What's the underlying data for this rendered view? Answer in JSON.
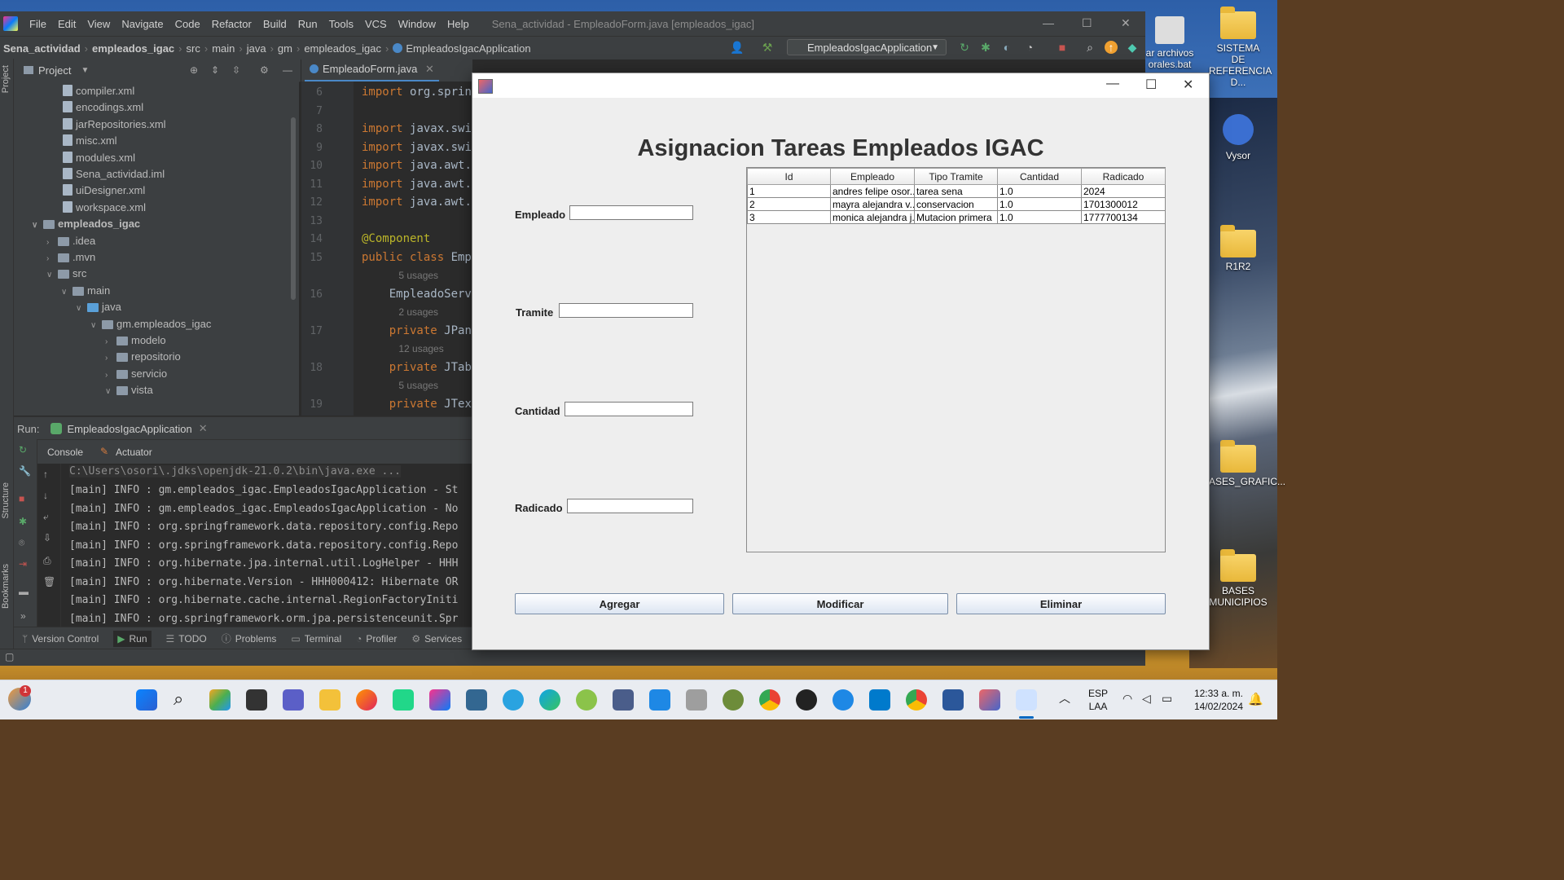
{
  "desktop": {
    "icons": [
      {
        "label": "ar archivos\norales.bat"
      },
      {
        "label": "SISTEMA DE\nREFERENCIA D..."
      },
      {
        "label": "Vysor"
      },
      {
        "label": "R1R2"
      },
      {
        "label": "ASES_GRAFIC..."
      },
      {
        "label": "BASES\nMUNICIPIOS"
      }
    ]
  },
  "ide": {
    "menu": [
      "File",
      "Edit",
      "View",
      "Navigate",
      "Code",
      "Refactor",
      "Build",
      "Run",
      "Tools",
      "VCS",
      "Window",
      "Help"
    ],
    "window_title": "Sena_actividad - EmpleadoForm.java [empleados_igac]",
    "breadcrumb": [
      "Sena_actividad",
      "empleados_igac",
      "src",
      "main",
      "java",
      "gm",
      "empleados_igac",
      "EmpleadosIgacApplication"
    ],
    "run_config": "EmpleadosIgacApplication",
    "project_label": "Project",
    "side_labels": {
      "project": "Project",
      "structure": "Structure",
      "bookmarks": "Bookmarks"
    },
    "tree": [
      {
        "label": "compiler.xml",
        "type": "xml"
      },
      {
        "label": "encodings.xml",
        "type": "xml"
      },
      {
        "label": "jarRepositories.xml",
        "type": "xml"
      },
      {
        "label": "misc.xml",
        "type": "xml"
      },
      {
        "label": "modules.xml",
        "type": "xml"
      },
      {
        "label": "Sena_actividad.iml",
        "type": "iml"
      },
      {
        "label": "uiDesigner.xml",
        "type": "xml"
      },
      {
        "label": "workspace.xml",
        "type": "xml"
      },
      {
        "label": "empleados_igac",
        "type": "folder"
      },
      {
        "label": ".idea",
        "type": "folder"
      },
      {
        "label": ".mvn",
        "type": "folder"
      },
      {
        "label": "src",
        "type": "folder"
      },
      {
        "label": "main",
        "type": "folder"
      },
      {
        "label": "java",
        "type": "folder"
      },
      {
        "label": "gm.empleados_igac",
        "type": "package"
      },
      {
        "label": "modelo",
        "type": "package"
      },
      {
        "label": "repositorio",
        "type": "package"
      },
      {
        "label": "servicio",
        "type": "package"
      },
      {
        "label": "vista",
        "type": "package"
      }
    ],
    "editor_tab": "EmpleadoForm.java",
    "code_lines": [
      {
        "n": "6",
        "parts": [
          [
            "kw",
            "import "
          ],
          [
            "",
            "org.spring"
          ]
        ]
      },
      {
        "n": "7",
        "parts": []
      },
      {
        "n": "8",
        "parts": [
          [
            "kw",
            "import "
          ],
          [
            "",
            "javax.swir"
          ]
        ]
      },
      {
        "n": "9",
        "parts": [
          [
            "kw",
            "import "
          ],
          [
            "",
            "javax.swir"
          ]
        ]
      },
      {
        "n": "10",
        "parts": [
          [
            "kw",
            "import "
          ],
          [
            "",
            "java.awt.*"
          ]
        ]
      },
      {
        "n": "11",
        "parts": [
          [
            "kw",
            "import "
          ],
          [
            "",
            "java.awt.e"
          ]
        ]
      },
      {
        "n": "12",
        "parts": [
          [
            "kw",
            "import "
          ],
          [
            "",
            "java.awt.e"
          ]
        ]
      },
      {
        "n": "13",
        "parts": []
      },
      {
        "n": "14",
        "parts": [
          [
            "an",
            "@Component"
          ]
        ]
      },
      {
        "n": "15",
        "parts": [
          [
            "kw",
            "public class "
          ],
          [
            "",
            "Empl"
          ]
        ]
      },
      {
        "n": "",
        "hint": "5 usages"
      },
      {
        "n": "16",
        "parts": [
          [
            "",
            "    EmpleadoServi"
          ]
        ]
      },
      {
        "n": "",
        "hint": "2 usages"
      },
      {
        "n": "17",
        "parts": [
          [
            "kw",
            "    private "
          ],
          [
            "",
            "JPane"
          ]
        ]
      },
      {
        "n": "",
        "hint": "12 usages"
      },
      {
        "n": "18",
        "parts": [
          [
            "kw",
            "    private "
          ],
          [
            "",
            "JTabl"
          ]
        ]
      },
      {
        "n": "",
        "hint": "5 usages"
      },
      {
        "n": "19",
        "parts": [
          [
            "kw",
            "    private "
          ],
          [
            "",
            "JText"
          ]
        ]
      }
    ],
    "run": {
      "label": "Run:",
      "tab": "EmpleadosIgacApplication",
      "console_tabs": [
        "Console",
        "Actuator"
      ],
      "console_lines": [
        "C:\\Users\\osori\\.jdks\\openjdk-21.0.2\\bin\\java.exe ...",
        "[main] INFO : gm.empleados_igac.EmpleadosIgacApplication - St",
        "[main] INFO : gm.empleados_igac.EmpleadosIgacApplication - No",
        "[main] INFO : org.springframework.data.repository.config.Repo",
        "[main] INFO : org.springframework.data.repository.config.Repo",
        "[main] INFO : org.hibernate.jpa.internal.util.LogHelper - HHH",
        "[main] INFO : org.hibernate.Version - HHH000412: Hibernate OR",
        "[main] INFO : org.hibernate.cache.internal.RegionFactoryIniti",
        "[main] INFO : org.springframework.orm.jpa.persistenceunit.Spr"
      ]
    },
    "bottom_tabs": [
      "Version Control",
      "Run",
      "TODO",
      "Problems",
      "Terminal",
      "Profiler",
      "Services"
    ]
  },
  "form": {
    "title": "Asignacion Tareas Empleados IGAC",
    "fields": {
      "empleado": {
        "label": "Empleado",
        "value": ""
      },
      "tramite": {
        "label": "Tramite",
        "value": ""
      },
      "cantidad": {
        "label": "Cantidad",
        "value": ""
      },
      "radicado": {
        "label": "Radicado",
        "value": ""
      }
    },
    "table": {
      "columns": [
        "Id",
        "Empleado",
        "Tipo Tramite",
        "Cantidad",
        "Radicado"
      ],
      "rows": [
        [
          "1",
          "andres felipe osor...",
          "tarea sena",
          "1.0",
          "2024"
        ],
        [
          "2",
          "mayra alejandra v...",
          "conservacion",
          "1.0",
          "1701300012"
        ],
        [
          "3",
          "monica alejandra j...",
          "Mutacion primera",
          "1.0",
          "1777700134"
        ]
      ]
    },
    "buttons": {
      "add": "Agregar",
      "edit": "Modificar",
      "delete": "Eliminar"
    }
  },
  "taskbar": {
    "notification_badge": "1",
    "language": "ESP",
    "layout": "LAA",
    "time": "12:33 a. m.",
    "date": "14/02/2024"
  },
  "colors": {
    "ide_bg": "#2b2b2b",
    "ide_panel": "#3c3f41",
    "accent": "#4a88c7",
    "keyword": "#cc7832",
    "annotation": "#bbb529"
  }
}
